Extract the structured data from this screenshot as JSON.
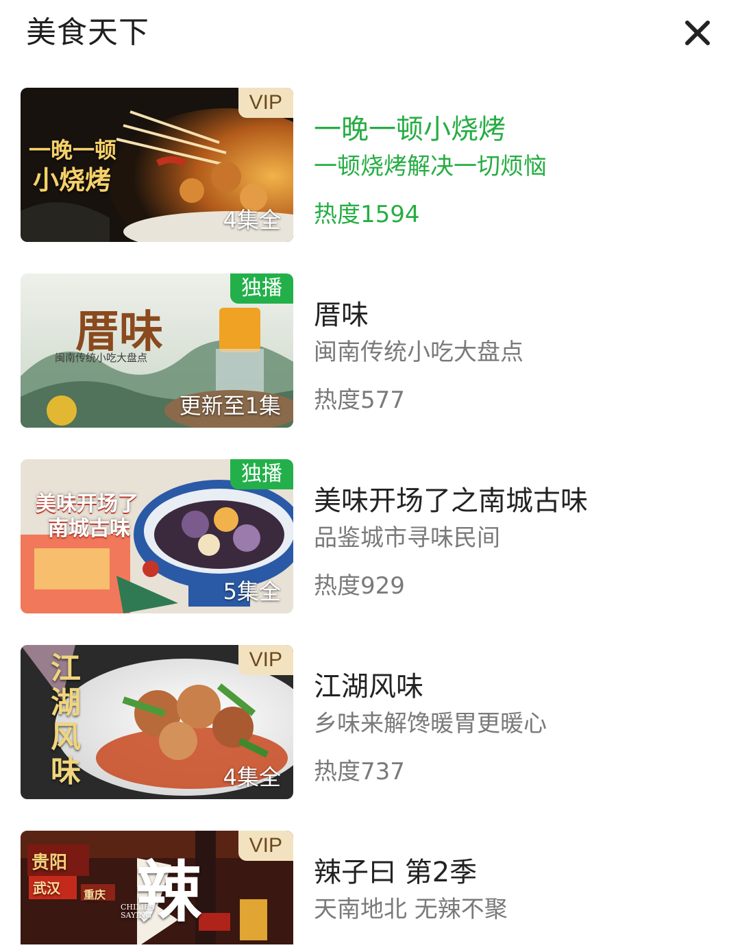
{
  "header": {
    "title": "美食天下",
    "close_icon": "close-icon"
  },
  "colors": {
    "accent_green": "#26ad43",
    "vip_badge_bg": "#f3e2c0",
    "exclusive_badge_bg": "#23b04a",
    "text_primary": "#222222",
    "text_secondary": "#7a7a7a"
  },
  "items": [
    {
      "title": "一晚一顿小烧烤",
      "subtitle": "一顿烧烤解决一切烦恼",
      "heat": "热度1594",
      "badge": "VIP",
      "episodes": "4集全",
      "cover_text": [
        "一晚一顿",
        "小烧烤"
      ],
      "active": true
    },
    {
      "title": "厝味",
      "subtitle": "闽南传统小吃大盘点",
      "heat": "热度577",
      "badge": "独播",
      "episodes": "更新至1集",
      "cover_text": [
        "厝味",
        "闽南传统小吃大盘点"
      ],
      "active": false
    },
    {
      "title": "美味开场了之南城古味",
      "subtitle": "品鉴城市寻味民间",
      "heat": "热度929",
      "badge": "独播",
      "episodes": "5集全",
      "cover_text": [
        "美味开场了",
        "南城古味"
      ],
      "active": false
    },
    {
      "title": "江湖风味",
      "subtitle": "乡味来解馋暖胃更暖心",
      "heat": "热度737",
      "badge": "VIP",
      "episodes": "4集全",
      "cover_text": [
        "江湖风味"
      ],
      "active": false
    },
    {
      "title": "辣子曰 第2季",
      "subtitle": "天南地北 无辣不聚",
      "heat": "",
      "badge": "VIP",
      "episodes": "",
      "cover_text": [
        "辣",
        "贵阳",
        "武汉",
        "重庆",
        "CHILIES SAYING"
      ],
      "active": false
    }
  ]
}
